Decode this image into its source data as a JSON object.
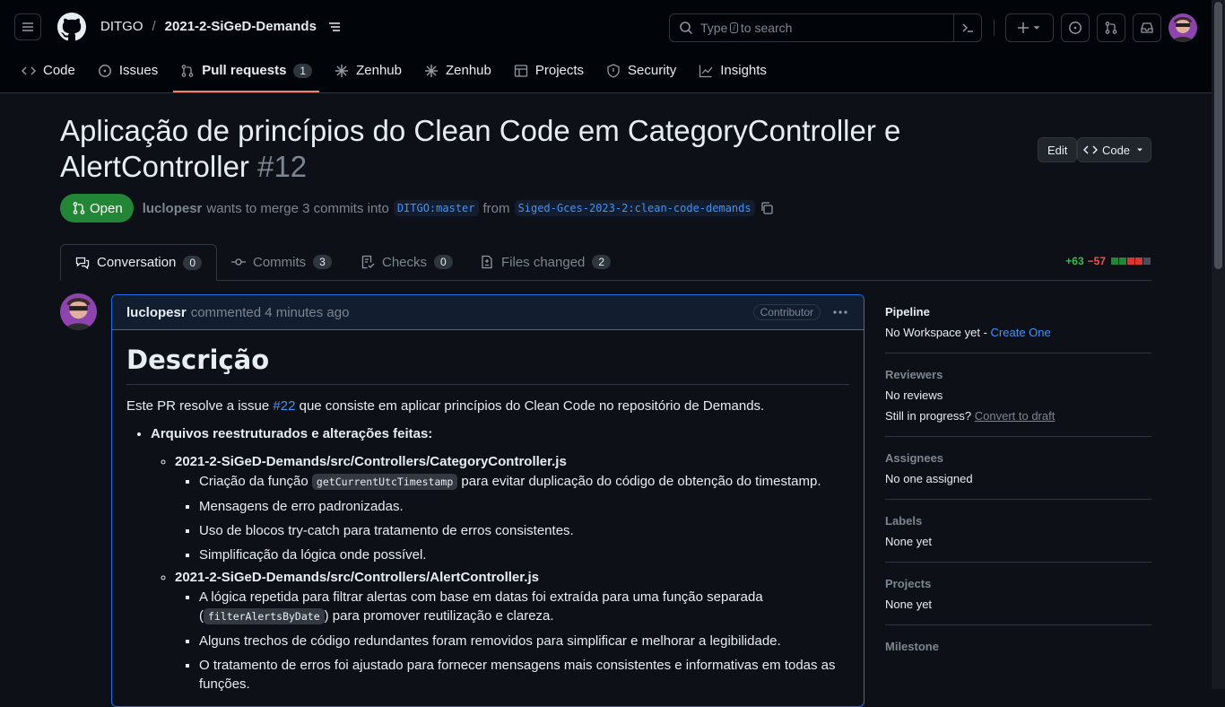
{
  "header": {
    "owner": "DITGO",
    "separator": "/",
    "repo": "2021-2-SiGeD-Demands",
    "search_prefix": "Type",
    "search_key": "/",
    "search_suffix": "to search"
  },
  "nav": {
    "code": "Code",
    "issues": "Issues",
    "pull_requests": "Pull requests",
    "pull_requests_count": "1",
    "zenhub1": "Zenhub",
    "zenhub2": "Zenhub",
    "projects": "Projects",
    "security": "Security",
    "insights": "Insights"
  },
  "pr": {
    "title": "Aplicação de princípios do Clean Code em CategoryController e AlertController",
    "number": "#12",
    "edit_label": "Edit",
    "code_label": "Code",
    "state": "Open",
    "author": "luclopesr",
    "merge_text": "wants to merge 3 commits into",
    "base_branch": "DITGO:master",
    "from_text": "from",
    "head_branch": "Siged-Gces-2023-2:clean-code-demands"
  },
  "pr_tabs": {
    "conversation": "Conversation",
    "conversation_count": "0",
    "commits": "Commits",
    "commits_count": "3",
    "checks": "Checks",
    "checks_count": "0",
    "files": "Files changed",
    "files_count": "2",
    "additions": "+63",
    "deletions": "−57"
  },
  "comment": {
    "author": "luclopesr",
    "time": "commented 4 minutes ago",
    "badge": "Contributor",
    "heading": "Descrição",
    "intro_before": "Este PR resolve a issue ",
    "intro_link": "#22",
    "intro_after": " que consiste em aplicar princípios do Clean Code no repositório de Demands.",
    "list_title": "Arquivos reestruturados e alterações feitas:",
    "file1": "2021-2-SiGeD-Demands/src/Controllers/CategoryController.js",
    "f1_item1_before": "Criação da função ",
    "f1_item1_code": "getCurrentUtcTimestamp",
    "f1_item1_after": " para evitar duplicação do código de obtenção do timestamp.",
    "f1_item2": "Mensagens de erro padronizadas.",
    "f1_item3": "Uso de blocos try-catch para tratamento de erros consistentes.",
    "f1_item4": "Simplificação da lógica onde possível.",
    "file2": "2021-2-SiGeD-Demands/src/Controllers/AlertController.js",
    "f2_item1_before": "A lógica repetida para filtrar alertas com base em datas foi extraída para uma função separada (",
    "f2_item1_code": "filterAlertsByDate",
    "f2_item1_after": ") para promover reutilização e clareza.",
    "f2_item2": "Alguns trechos de código redundantes foram removidos para simplificar e melhorar a legibilidade.",
    "f2_item3": "O tratamento de erros foi ajustado para fornecer mensagens mais consistentes e informativas em todas as funções."
  },
  "sidebar": {
    "pipeline_title": "Pipeline",
    "pipeline_value": "No Workspace yet - ",
    "pipeline_link": "Create One",
    "reviewers_title": "Reviewers",
    "reviewers_value": "No reviews",
    "progress_text": "Still in progress?",
    "progress_link": "Convert to draft",
    "assignees_title": "Assignees",
    "assignees_value": "No one assigned",
    "labels_title": "Labels",
    "labels_value": "None yet",
    "projects_title": "Projects",
    "projects_value": "None yet",
    "milestone_title": "Milestone"
  },
  "colors": {
    "accent_open": "#238636",
    "active_tab": "#f78166",
    "link": "#4493f8",
    "additions": "#3fb950",
    "deletions": "#f85149"
  }
}
